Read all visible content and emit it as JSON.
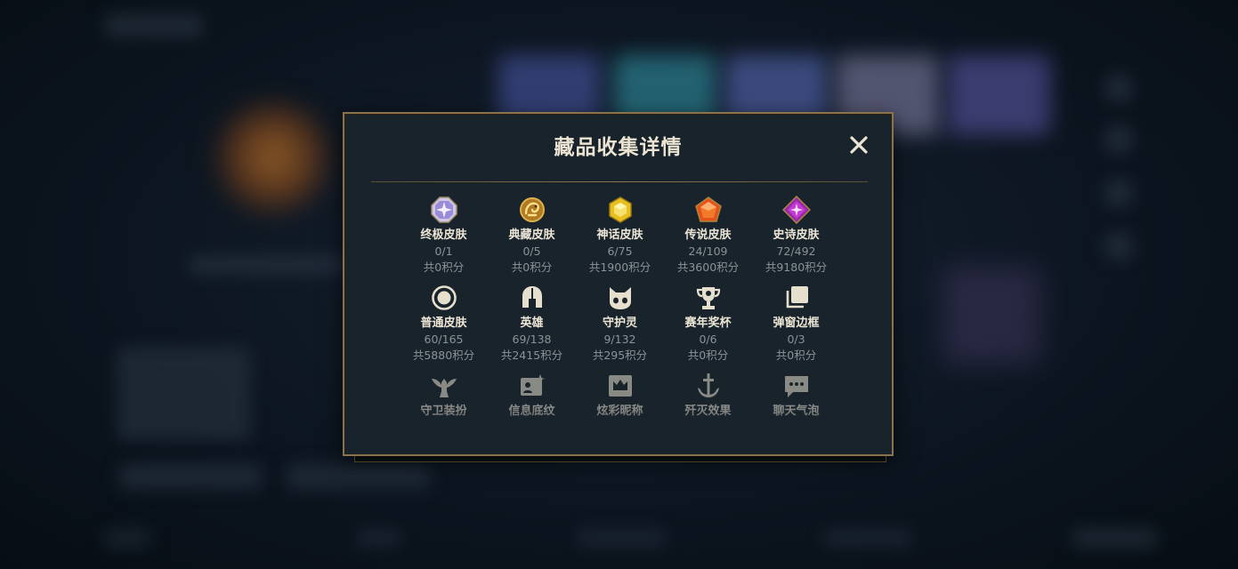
{
  "dialog": {
    "title": "藏品收集详情",
    "close_icon": "close-icon"
  },
  "items": [
    {
      "name": "终极皮肤",
      "count": "0/1",
      "points": "共0积分",
      "icon": "octagon-gem-icon"
    },
    {
      "name": "典藏皮肤",
      "count": "0/5",
      "points": "共0积分",
      "icon": "dragon-emblem-icon"
    },
    {
      "name": "神话皮肤",
      "count": "6/75",
      "points": "共1900积分",
      "icon": "hexagon-gem-icon"
    },
    {
      "name": "传说皮肤",
      "count": "24/109",
      "points": "共3600积分",
      "icon": "pentagon-gem-icon"
    },
    {
      "name": "史诗皮肤",
      "count": "72/492",
      "points": "共9180积分",
      "icon": "diamond-gem-icon"
    },
    {
      "name": "普通皮肤",
      "count": "60/165",
      "points": "共5880积分",
      "icon": "ring-icon"
    },
    {
      "name": "英雄",
      "count": "69/138",
      "points": "共2415积分",
      "icon": "helmet-icon"
    },
    {
      "name": "守护灵",
      "count": "9/132",
      "points": "共295积分",
      "icon": "cat-face-icon"
    },
    {
      "name": "赛年奖杯",
      "count": "0/6",
      "points": "共0积分",
      "icon": "trophy-icon"
    },
    {
      "name": "弹窗边框",
      "count": "0/3",
      "points": "共0积分",
      "icon": "stacked-frames-icon"
    },
    {
      "name": "守卫装扮",
      "icon": "winged-ward-icon"
    },
    {
      "name": "信息底纹",
      "icon": "profile-card-icon"
    },
    {
      "name": "炫彩昵称",
      "icon": "crown-banner-icon"
    },
    {
      "name": "歼灭效果",
      "icon": "anchor-sword-icon"
    },
    {
      "name": "聊天气泡",
      "icon": "chat-bubble-icon"
    }
  ],
  "colors": {
    "gold_border": "#8a734b",
    "panel_bg": "#18232b",
    "title_text": "#ece4d2",
    "muted_text": "#8b9399"
  }
}
